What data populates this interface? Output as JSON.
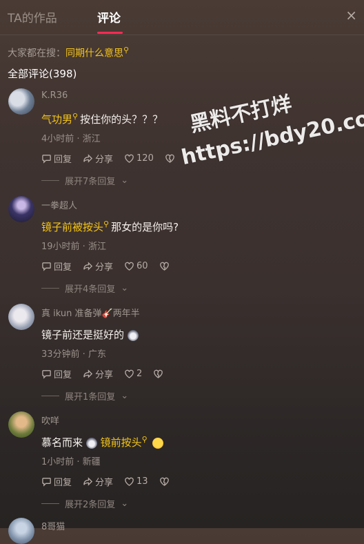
{
  "tabs": {
    "works": "TA的作品",
    "comments": "评论"
  },
  "close_glyph": "×",
  "trending": {
    "prefix": "大家都在搜：",
    "keyword": "同期什么意思"
  },
  "comment_count": "全部评论(398)",
  "watermark": {
    "line1": "黑料不打烊",
    "line2": "https://bdy20.co"
  },
  "labels": {
    "reply": "回复",
    "share": "分享"
  },
  "comments": [
    {
      "user": "K.R36",
      "kw": "气功男",
      "text": "按住你的头？？？",
      "meta": "4小时前 · 浙江",
      "likes": "120",
      "replies": "展开7条回复",
      "avatar_color": "#6f7f95"
    },
    {
      "user": "一拳超人",
      "kw": "镜子前被按头",
      "text": "那女的是你吗?",
      "meta": "19小时前 · 浙江",
      "likes": "60",
      "replies": "展开4条回复",
      "avatar_color": "#2d2a4a"
    },
    {
      "user": "真 ikun 准备弹",
      "user_suffix": "两年半",
      "text": "镜子前还是挺好的",
      "meta": "33分钟前 · 广东",
      "likes": "2",
      "replies": "展开1条回复",
      "avatar_color": "#9aa3b5"
    },
    {
      "user": "吹咩",
      "text": "慕名而来",
      "kw": "镜前按头",
      "meta": "1小时前 · 新疆",
      "likes": "13",
      "replies": "展开2条回复",
      "avatar_color": "#6b7a3a"
    },
    {
      "user": "8哥猫",
      "avatar_color": "#7c8ea6"
    }
  ],
  "colors": {
    "accent": "#fe2c55",
    "keyword": "#f5c518"
  },
  "icons": [
    "search-icon",
    "reply-icon",
    "share-icon",
    "heart-icon",
    "dislike-icon",
    "chevron-down-icon",
    "close-icon"
  ]
}
